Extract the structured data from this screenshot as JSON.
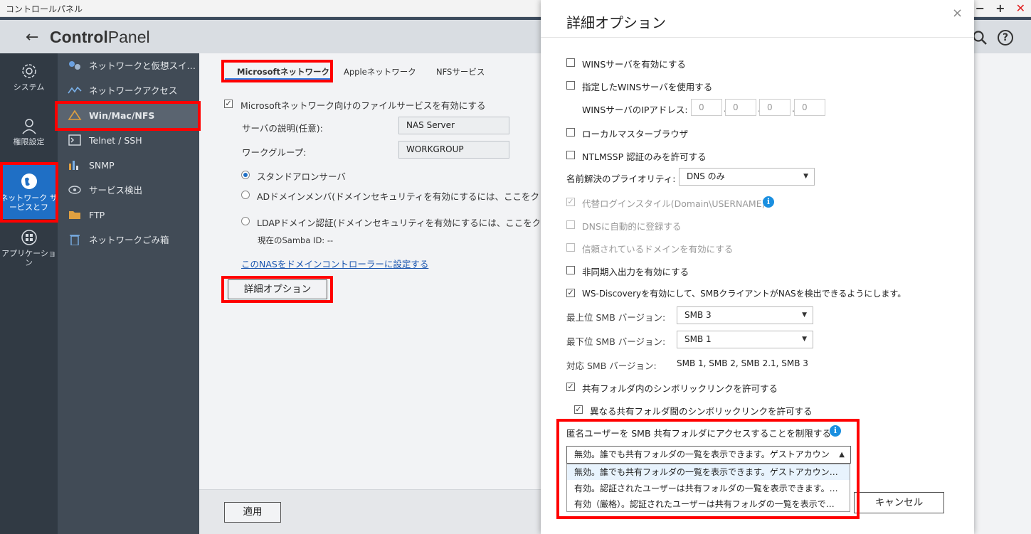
{
  "window": {
    "title": "コントロールパネル",
    "controls": [
      "−",
      "+",
      "✕"
    ]
  },
  "header": {
    "title_bold": "Control",
    "title_rest": "Panel"
  },
  "leftnav": [
    {
      "label": "システム"
    },
    {
      "label": "権限設定"
    },
    {
      "label": "ネットワーク サービスとフ"
    },
    {
      "label": "アプリケーション"
    }
  ],
  "subnav": [
    {
      "label": "ネットワークと仮想スイ…"
    },
    {
      "label": "ネットワークアクセス"
    },
    {
      "label": "Win/Mac/NFS"
    },
    {
      "label": "Telnet / SSH"
    },
    {
      "label": "SNMP"
    },
    {
      "label": "サービス検出"
    },
    {
      "label": "FTP"
    },
    {
      "label": "ネットワークごみ箱"
    }
  ],
  "main": {
    "tabs": [
      "Microsoftネットワーク",
      "Appleネットワーク",
      "NFSサービス"
    ],
    "enable_label": "Microsoftネットワーク向けのファイルサービスを有効にする",
    "server_desc_label": "サーバの説明(任意):",
    "server_desc_value": "NAS Server",
    "workgroup_label": "ワークグループ:",
    "workgroup_value": "WORKGROUP",
    "radio_standalone": "スタンドアロンサーバ",
    "radio_ad": "ADドメインメンバ(ドメインセキュリティを有効にするには、ここをクリッ",
    "radio_ldap": "LDAPドメイン認証(ドメインセキュリティを有効にするには、ここをクリッ",
    "samba_id": "現在のSamba ID: --",
    "dc_link": "このNASをドメインコントローラーに設定する",
    "advanced_button": "詳細オプション",
    "apply_button": "適用"
  },
  "dialog": {
    "title": "詳細オプション",
    "close": "×",
    "wins_enable": "WINSサーバを有効にする",
    "wins_use": "指定したWINSサーバを使用する",
    "wins_ip_label": "WINSサーバのIPアドレス:",
    "wins_ip": [
      "0",
      "0",
      "0",
      "0"
    ],
    "local_master": "ローカルマスターブラウザ",
    "ntlmssp": "NTLMSSP 認証のみを許可する",
    "name_priority_label": "名前解決のプライオリティ:",
    "name_priority_value": "DNS のみ",
    "alt_login": "代替ログインスタイル(Domain\\USERNAME)",
    "dns_register": "DNSに自動的に登録する",
    "trusted_domains": "信頼されているドメインを有効にする",
    "async_io": "非同期入出力を有効にする",
    "ws_discovery": "WS-Discoveryを有効にして、SMBクライアントがNASを検出できるようにします。",
    "max_smb_label": "最上位 SMB バージョン:",
    "max_smb_value": "SMB 3",
    "min_smb_label": "最下位 SMB バージョン:",
    "min_smb_value": "SMB 1",
    "supported_smb_label": "対応 SMB バージョン:",
    "supported_smb_value": "SMB 1, SMB 2, SMB 2.1, SMB 3",
    "symlink_shared": "共有フォルダ内のシンボリックリンクを許可する",
    "symlink_between": "異なる共有フォルダ間のシンボリックリンクを許可する",
    "anon_label": "匿名ユーザーを SMB 共有フォルダにアクセスすることを制限する",
    "anon_selected": "無効。誰でも共有フォルダの一覧を表示できます。ゲストアカウン",
    "anon_options": [
      "無効。誰でも共有フォルダの一覧を表示できます。ゲストアカウン…",
      "有効。認証されたユーザーは共有フォルダの一覧を表示できます。…",
      "有効（厳格）。認証されたユーザーは共有フォルダの一覧を表示で…"
    ],
    "cancel_button": "キャンセル"
  },
  "colors": {
    "accent": "#1f6fc5",
    "highlight": "#ff0000",
    "nav_bg": "#313a44",
    "subnav_bg": "#414b56"
  }
}
